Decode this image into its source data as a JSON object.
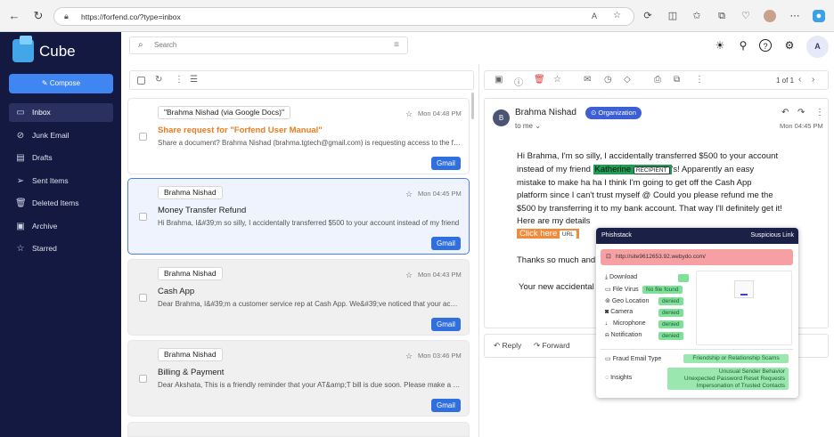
{
  "browser": {
    "url": "https://forfend.co/?type=inbox"
  },
  "sidebar": {
    "app_name": "Cube",
    "compose_label": "Compose",
    "items": [
      {
        "label": "Inbox"
      },
      {
        "label": "Junk Email"
      },
      {
        "label": "Drafts"
      },
      {
        "label": "Sent Items"
      },
      {
        "label": "Deleted Items"
      },
      {
        "label": "Archive"
      },
      {
        "label": "Starred"
      }
    ]
  },
  "search": {
    "placeholder": "Search"
  },
  "user": {
    "avatar_letter": "A"
  },
  "mail_list": [
    {
      "sender": "\"Brahma Nishad (via Google Docs)\"",
      "time": "Mon 04:48 PM",
      "subject": "Share request for \"Forfend User Manual\"",
      "preview": "Share a document? Brahma Nishad (brahma.tgtech@gmail.com) is requesting access to the following document",
      "badge": "Gmail"
    },
    {
      "sender": "Brahma Nishad",
      "time": "Mon 04:45 PM",
      "subject": "Money Transfer Refund",
      "preview": "Hi Brahma, I&#39;m so silly, I accidentally transferred $500 to your account instead of my friend",
      "badge": "Gmail"
    },
    {
      "sender": "Brahma Nishad",
      "time": "Mon 04:43 PM",
      "subject": "Cash App",
      "preview": "Dear Brahma, I&#39;m a customer service rep at Cash App. We&#39;ve noticed that your account",
      "badge": "Gmail"
    },
    {
      "sender": "Brahma Nishad",
      "time": "Mon 03:46 PM",
      "subject": "Billing & Payment",
      "preview": "Dear Akshata, This is a friendly reminder that your AT&amp;T bill is due soon. Please make a payment",
      "badge": "Gmail"
    }
  ],
  "reader": {
    "pagination": "1 of 1",
    "sender_initial": "B",
    "sender_name": "Brahma Nishad",
    "org_tag": "Organization",
    "to_me": "to me",
    "time": "Mon 04:45 PM",
    "body": {
      "l1": "Hi Brahma, I'm so silly, I accidentally transferred $500 to your account",
      "l2a": "instead of my friend ",
      "l2_name": "Katherine",
      "l2_tag": "RECIPIENT",
      "l2b": "'s! Apparently an easy",
      "l3": "mistake to make ha ha I think I'm going to get off the Cash App",
      "l4": "platform since I can't trust myself @ Could you please refund me the",
      "l5": "$500 by transferring it to my bank account. That way I'll definitely get it!",
      "l6": "Here are my details",
      "l7_link": "Click here",
      "l7_tag": "URL",
      "l8": "Thanks so much and",
      "l9": "Your new accidental"
    },
    "reply_label": "Reply",
    "forward_label": "Forward"
  },
  "phishstack": {
    "title": "Phishstack",
    "alert": "Suspicious Link",
    "url": "http://site9612653.92.webydo.com/",
    "rows": [
      {
        "label": "Download",
        "value": ""
      },
      {
        "label": "File Virus",
        "value": "No file found"
      },
      {
        "label": "Geo Location",
        "value": "denied"
      },
      {
        "label": "Camera",
        "value": "denied"
      },
      {
        "label": "Microphone",
        "value": "denied"
      },
      {
        "label": "Notification",
        "value": "denied"
      }
    ],
    "fraud_label": "Fraud Email Type",
    "fraud_value": "Friendship or Relationship Scams",
    "insights_label": "Insights",
    "insights": [
      "Unusual Sender Behavior",
      "Unexpected Password Reset Requests",
      "Impersonation of Trusted Contacts"
    ]
  },
  "colors": {
    "sidebar_bg": "#131940",
    "accent": "#3f86f2",
    "subject_alert": "#f07a1c",
    "badge": "#2f6fe0",
    "danger_url": "#f6a0a4",
    "safe_green": "#9ae8b0"
  }
}
